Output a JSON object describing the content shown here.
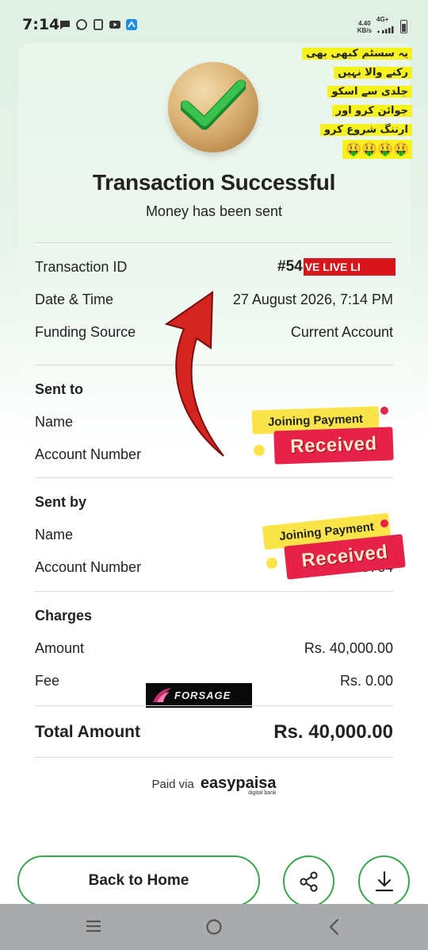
{
  "status_bar": {
    "time": "7:14",
    "net_speed_value": "4.40",
    "net_speed_unit": "KB/s",
    "network_type": "4G+"
  },
  "header": {
    "title": "Transaction Successful",
    "subtitle": "Money has been sent"
  },
  "overlay_note": {
    "lines": [
      "یہ سسٹم کبھی بھی",
      "رکنے والا نہیں",
      "جلدی سے اسکو",
      "جوائن کرو اور",
      "ارننگ شروع کرو"
    ],
    "emoji": "🤑🤑🤑🤑"
  },
  "details": {
    "transaction_id_label": "Transaction ID",
    "transaction_id_value": "#54",
    "live_text": "VE LIVE LI",
    "datetime_label": "Date & Time",
    "datetime_value": "27 August 2026, 7:14 PM",
    "funding_label": "Funding Source",
    "funding_value": "Current Account"
  },
  "sent_to": {
    "heading": "Sent to",
    "name_label": "Name",
    "account_label": "Account Number"
  },
  "sent_by": {
    "heading": "Sent by",
    "name_label": "Name",
    "account_label": "Account Number",
    "account_partial": "+.55764"
  },
  "charges": {
    "heading": "Charges",
    "amount_label": "Amount",
    "amount_value": "Rs. 40,000.00",
    "fee_label": "Fee",
    "fee_value": "Rs. 0.00"
  },
  "total": {
    "label": "Total Amount",
    "value": "Rs. 40,000.00"
  },
  "stickers": {
    "top_text": "Joining Payment",
    "bottom_text": "Received"
  },
  "forsage_logo": "FORSAGE",
  "footer": {
    "paid_via": "Paid via",
    "brand": "easypaisa",
    "brand_sub": "digital bank"
  },
  "actions": {
    "back_home": "Back to Home"
  },
  "icons": {
    "success": "checkmark-icon",
    "share": "share-icon",
    "download": "download-icon"
  },
  "colors": {
    "accent_green": "#39a64c",
    "sticker_red": "#e6214a",
    "sticker_yellow": "#fbe44a"
  }
}
